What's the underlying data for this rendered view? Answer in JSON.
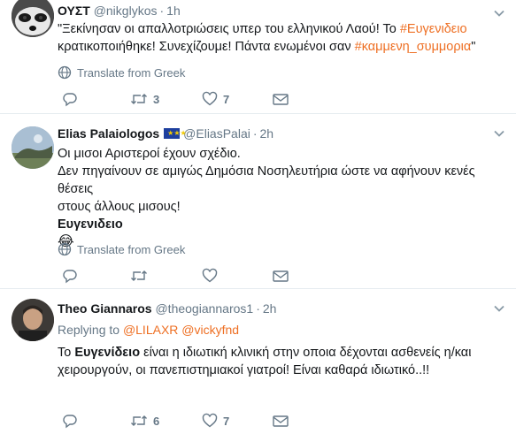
{
  "tweets": [
    {
      "name": "ΟΥΣΤ",
      "handle": "@nikglykos",
      "time": "1h",
      "text_1": "\"Ξεκίνησαν οι απαλλοτριώσεις υπερ του ελληνικού Λαού! Το ",
      "hashtag_1": "#Ευγενιδειο",
      "text_2": "κρατικοποιήθηκε! Συνεχίζουμε! Πάντα ενωμένοι σαν ",
      "hashtag_2": "#καμμενη_συμμορια",
      "text_3": "\"",
      "translate": "Translate from Greek",
      "retweets": "3",
      "likes": "7"
    },
    {
      "name": "Elias Palaiologos",
      "flag_stars": "★★★",
      "handle": "@EliasPalai",
      "time": "2h",
      "line_1": "Οι μισοι Αριστεροί έχουν σχέδιο.",
      "line_2": "Δεν πηγαίνουν σε αμιγώς Δημόσια Νοσηλευτήρια ώστε να αφήνουν κενές θέσεις",
      "line_3": "στους άλλους μισους!",
      "line_4": "Ευγενιδειο",
      "emoji": "😂",
      "translate": "Translate from Greek"
    },
    {
      "name": "Theo Giannaros",
      "handle": "@theogiannaros1",
      "time": "2h",
      "replying_label": "Replying to ",
      "replying_to_1": "@LILAXR",
      "replying_to_2": "@vickyfnd",
      "text_1": "Το ",
      "bold": "Ευγενίδειο",
      "text_2": " είναι η ιδιωτική κλινική στην οποια δέχονται ασθενείς η/και",
      "line_2": "χειρουργούν, οι πανεπιστημιακοί γιατροί! Είναι καθαρά ιδιωτικό..!!",
      "retweets": "6",
      "likes": "7"
    }
  ],
  "colors": {
    "hashtag": "#ee6f23",
    "muted": "#657786",
    "divider": "#e6ecf0"
  }
}
